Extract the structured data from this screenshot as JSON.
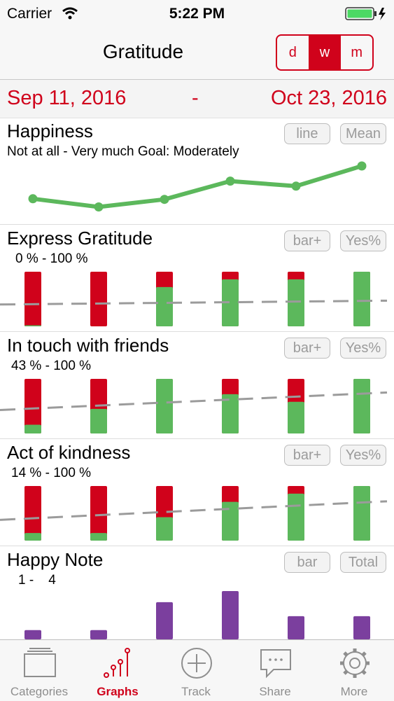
{
  "status": {
    "carrier": "Carrier",
    "time": "5:22 PM"
  },
  "nav": {
    "title": "Gratitude",
    "segments": [
      "d",
      "w",
      "m"
    ],
    "active_segment": "w"
  },
  "dates": {
    "start": "Sep 11, 2016",
    "separator": "-",
    "end": "Oct 23, 2016"
  },
  "colors": {
    "accent": "#d0021b",
    "green": "#5cb85c",
    "purple": "#7b3f9e",
    "trend": "#9b9b9b"
  },
  "sections": {
    "happiness": {
      "title": "Happiness",
      "subtitle": "Not at all - Very much Goal: Moderately",
      "btn1": "line",
      "btn2": "Mean"
    },
    "express": {
      "title": "Express Gratitude",
      "range": "0 % - 100 %",
      "btn1": "bar+",
      "btn2": "Yes%"
    },
    "touch": {
      "title": "In touch with friends",
      "range": "43 % - 100 %",
      "btn1": "bar+",
      "btn2": "Yes%"
    },
    "kindness": {
      "title": "Act of kindness",
      "range": "14 % - 100 %",
      "btn1": "bar+",
      "btn2": "Yes%"
    },
    "note": {
      "title": "Happy Note",
      "range": "1 -    4",
      "btn1": "bar",
      "btn2": "Total"
    }
  },
  "chart_data": [
    {
      "type": "line",
      "name": "Happiness",
      "values": [
        0.38,
        0.25,
        0.37,
        0.66,
        0.58,
        0.9
      ],
      "ylim": [
        0,
        1
      ]
    },
    {
      "type": "bar",
      "name": "Express Gratitude",
      "yes_fraction": [
        0.02,
        0.0,
        0.72,
        0.86,
        0.86,
        1.0
      ],
      "trend": [
        0.4,
        0.47
      ]
    },
    {
      "type": "bar",
      "name": "In touch with friends",
      "yes_fraction": [
        0.16,
        0.45,
        1.0,
        0.72,
        0.58,
        1.0
      ],
      "trend": [
        0.43,
        0.75
      ]
    },
    {
      "type": "bar",
      "name": "Act of kindness",
      "yes_fraction": [
        0.14,
        0.14,
        0.43,
        0.71,
        0.86,
        1.0
      ],
      "trend": [
        0.38,
        0.72
      ]
    },
    {
      "type": "bar",
      "name": "Happy Note",
      "values": [
        1,
        1,
        4,
        5.2,
        2.5,
        2.5
      ],
      "ylim": [
        0,
        5.5
      ]
    }
  ],
  "tabs": [
    {
      "label": "Categories",
      "icon": "folder-icon",
      "active": false
    },
    {
      "label": "Graphs",
      "icon": "graph-icon",
      "active": true
    },
    {
      "label": "Track",
      "icon": "plus-circle-icon",
      "active": false
    },
    {
      "label": "Share",
      "icon": "speech-bubble-icon",
      "active": false
    },
    {
      "label": "More",
      "icon": "gear-icon",
      "active": false
    }
  ]
}
